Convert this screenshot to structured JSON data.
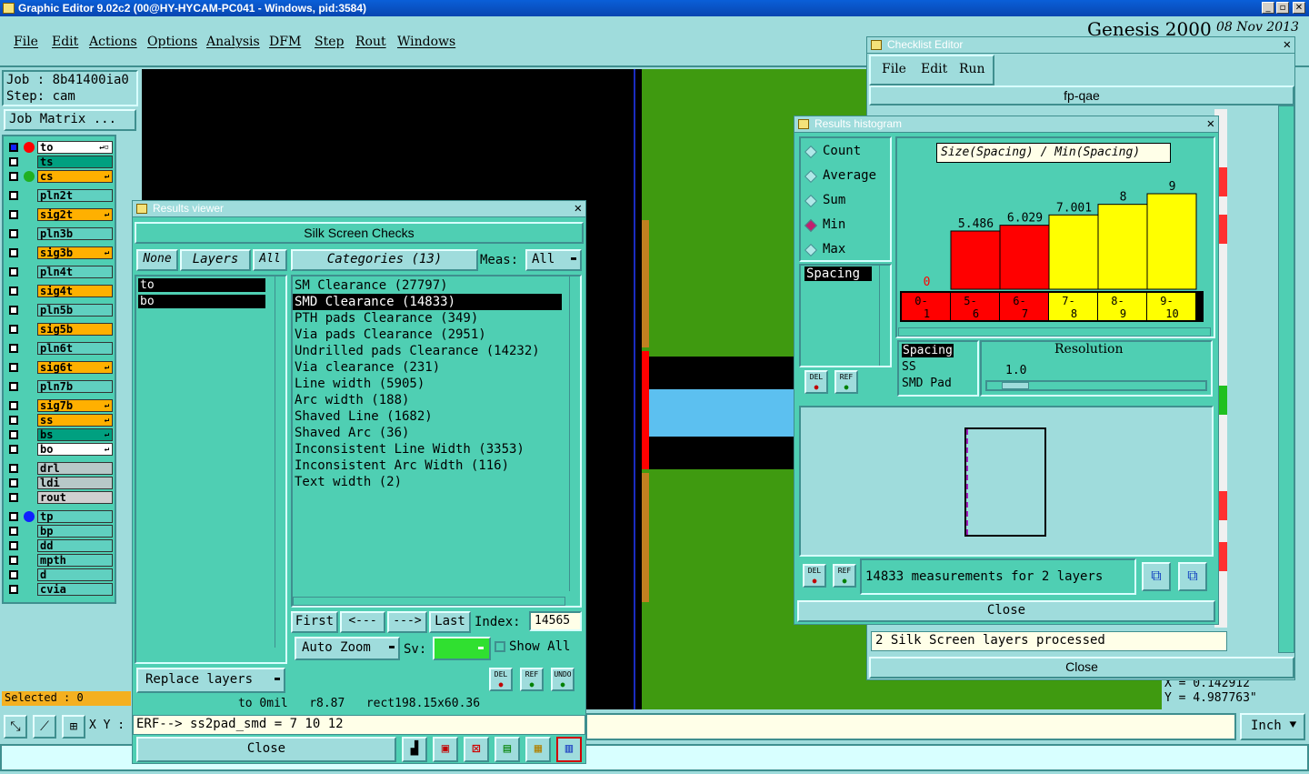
{
  "app": {
    "title": "Graphic Editor 9.02c2 (00@HY-HYCAM-PC041 - Windows, pid:3584)",
    "brand": "Genesis 2000",
    "date": "08 Nov 2013",
    "menu": [
      "File",
      "Edit",
      "Actions",
      "Options",
      "Analysis",
      "DFM",
      "Step",
      "Rout",
      "Windows"
    ]
  },
  "job": {
    "job_label": "Job : 8b41400ia0",
    "step_label": "Step: cam",
    "matrix_button": "Job Matrix ..."
  },
  "layers": [
    {
      "name": "to",
      "color": "#ffffff",
      "dot": "#ff0000",
      "arrow": "↵▫"
    },
    {
      "name": "ts",
      "color": "#00a080",
      "dot": "",
      "arrow": ""
    },
    {
      "name": "cs",
      "color": "#ffb000",
      "dot": "#20b020",
      "arrow": "↵"
    },
    {
      "name": "pln2t",
      "color": "#60d0c0",
      "dot": "",
      "arrow": ""
    },
    {
      "name": "sig2t",
      "color": "#ffb000",
      "dot": "",
      "arrow": "↵"
    },
    {
      "name": "pln3b",
      "color": "#60d0c0",
      "dot": "",
      "arrow": ""
    },
    {
      "name": "sig3b",
      "color": "#ffb000",
      "dot": "",
      "arrow": "↵"
    },
    {
      "name": "pln4t",
      "color": "#60d0c0",
      "dot": "",
      "arrow": ""
    },
    {
      "name": "sig4t",
      "color": "#ffb000",
      "dot": "",
      "arrow": ""
    },
    {
      "name": "pln5b",
      "color": "#60d0c0",
      "dot": "",
      "arrow": ""
    },
    {
      "name": "sig5b",
      "color": "#ffb000",
      "dot": "",
      "arrow": ""
    },
    {
      "name": "pln6t",
      "color": "#60d0c0",
      "dot": "",
      "arrow": ""
    },
    {
      "name": "sig6t",
      "color": "#ffb000",
      "dot": "",
      "arrow": "↵"
    },
    {
      "name": "pln7b",
      "color": "#60d0c0",
      "dot": "",
      "arrow": ""
    },
    {
      "name": "sig7b",
      "color": "#ffb000",
      "dot": "",
      "arrow": "↵"
    },
    {
      "name": "ss",
      "color": "#ffb000",
      "dot": "",
      "arrow": "↵"
    },
    {
      "name": "bs",
      "color": "#00a080",
      "dot": "",
      "arrow": "↵"
    },
    {
      "name": "bo",
      "color": "#ffffff",
      "dot": "",
      "arrow": "↵"
    },
    {
      "name": "drl",
      "color": "#b8c8c8",
      "dot": "",
      "arrow": ""
    },
    {
      "name": "ldi",
      "color": "#b8c8c8",
      "dot": "",
      "arrow": ""
    },
    {
      "name": "rout",
      "color": "#d0d0d0",
      "dot": "",
      "arrow": ""
    },
    {
      "name": "tp",
      "color": "#60d0c0",
      "dot": "#1020ff",
      "arrow": ""
    },
    {
      "name": "bp",
      "color": "#60d0c0",
      "dot": "",
      "arrow": ""
    },
    {
      "name": "dd",
      "color": "#60d0c0",
      "dot": "",
      "arrow": ""
    },
    {
      "name": "mpth",
      "color": "#60d0c0",
      "dot": "",
      "arrow": ""
    },
    {
      "name": "d",
      "color": "#60d0c0",
      "dot": "",
      "arrow": ""
    },
    {
      "name": "cvia",
      "color": "#60d0c0",
      "dot": "",
      "arrow": ""
    }
  ],
  "status": {
    "selected": "Selected : 0",
    "xy_label": "X Y :",
    "units": "Inch",
    "coord_x": "X = 0.142912",
    "coord_y": "Y = 4.987763\""
  },
  "results_viewer": {
    "title": "Results viewer",
    "header": "Silk Screen Checks",
    "tabs": [
      "None",
      "Layers",
      "All"
    ],
    "layers": [
      "to",
      "bo"
    ],
    "categories_label": "Categories (13)",
    "meas_label": "Meas:",
    "meas_value": "All",
    "categories": [
      "SM Clearance (27797)",
      "SMD Clearance (14833)",
      "PTH pads Clearance (349)",
      "Via pads Clearance (2951)",
      "Undrilled pads Clearance (14232)",
      "Via clearance (231)",
      "Line width (5905)",
      "Arc width (188)",
      "Shaved Line (1682)",
      "Shaved Arc (36)",
      "Inconsistent Line Width (3353)",
      "Inconsistent Arc Width (116)",
      "Text width (2)"
    ],
    "selected_index": 1,
    "nav": {
      "first": "First",
      "prev": "<---",
      "next": "--->",
      "last": "Last",
      "index_label": "Index:",
      "index_value": "14565"
    },
    "auto_zoom": "Auto Zoom",
    "sv_label": "Sv:",
    "show_all": "Show All",
    "replace_layers": "Replace layers",
    "icon_labels": [
      "DEL",
      "REF",
      "UNDO"
    ],
    "info_line": "to 0mil   r8.87   rect198.15x60.36",
    "erf_line": "ERF--> ss2pad_smd = 7 10 12",
    "close": "Close"
  },
  "checklist_editor": {
    "title": "Checklist Editor",
    "menu": [
      "File",
      "Edit",
      "Run"
    ],
    "name": "fp-qae",
    "status": "2 Silk Screen layers processed",
    "close": "Close"
  },
  "histogram": {
    "title": "Results histogram",
    "modes": [
      "Count",
      "Average",
      "Sum",
      "Min",
      "Max"
    ],
    "selected_mode": "Min",
    "list_item": "Spacing",
    "chart_title": "Size(Spacing) / Min(Spacing)",
    "resolution_label": "Resolution",
    "resolution_value": "1.0",
    "res_list": [
      "Spacing",
      "SS",
      "SMD Pad"
    ],
    "measurements": "14833 measurements for 2 layers",
    "close": "Close",
    "icon_labels": [
      "DEL",
      "REF"
    ]
  },
  "chart_data": {
    "type": "bar",
    "title": "Size(Spacing) / Min(Spacing)",
    "categories": [
      "0-1",
      "5-6",
      "6-7",
      "7-8",
      "8-9",
      "9-10"
    ],
    "category_lines": [
      [
        "0-",
        "1"
      ],
      [
        "5-",
        "6"
      ],
      [
        "6-",
        "7"
      ],
      [
        "7-",
        "8"
      ],
      [
        "8-",
        "9"
      ],
      [
        "9-",
        "10"
      ]
    ],
    "values": [
      0,
      5.486,
      6.029,
      7.001,
      8,
      9
    ],
    "value_labels": [
      "0",
      "5.486",
      "6.029",
      "7.001",
      "8",
      "9"
    ],
    "colors": [
      "#ff0000",
      "#ff0000",
      "#ff0000",
      "#ffff00",
      "#ffff00",
      "#ffff00"
    ],
    "ylim": [
      0,
      9.6
    ]
  }
}
